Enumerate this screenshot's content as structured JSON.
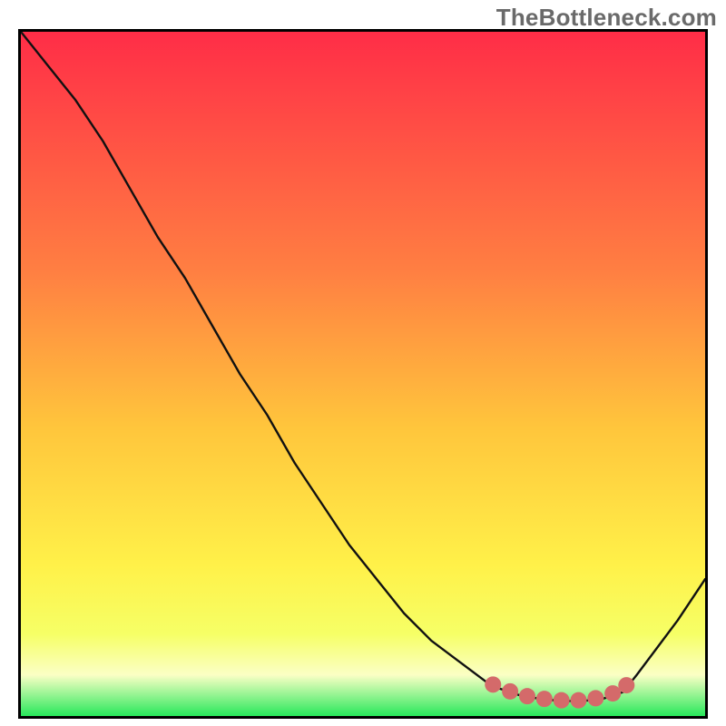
{
  "watermark": "TheBottleneck.com",
  "colors": {
    "border": "#000000",
    "curve": "#111111",
    "highlight": "#d46a6a",
    "g_top": "#ff2d47",
    "g_mid1": "#ff7f42",
    "g_mid2": "#ffc63c",
    "g_mid3": "#fff149",
    "g_mid4": "#f6ff66",
    "g_mid5": "#fbffc5",
    "g_bottom": "#28e85b"
  },
  "chart_data": {
    "type": "line",
    "title": "",
    "xlabel": "",
    "ylabel": "",
    "x": [
      0.0,
      0.04,
      0.08,
      0.12,
      0.16,
      0.2,
      0.24,
      0.28,
      0.32,
      0.36,
      0.4,
      0.44,
      0.48,
      0.52,
      0.56,
      0.6,
      0.64,
      0.68,
      0.7,
      0.73,
      0.76,
      0.79,
      0.82,
      0.85,
      0.88,
      0.9,
      0.93,
      0.96,
      1.0
    ],
    "y": [
      1.0,
      0.95,
      0.9,
      0.84,
      0.77,
      0.7,
      0.64,
      0.57,
      0.5,
      0.44,
      0.37,
      0.31,
      0.25,
      0.2,
      0.15,
      0.11,
      0.08,
      0.05,
      0.04,
      0.03,
      0.025,
      0.022,
      0.022,
      0.025,
      0.035,
      0.06,
      0.1,
      0.14,
      0.2
    ],
    "xlim": [
      0,
      1
    ],
    "ylim": [
      0,
      1
    ],
    "highlight_x_range": [
      0.68,
      0.9
    ],
    "highlight_points_x": [
      0.69,
      0.715,
      0.74,
      0.765,
      0.79,
      0.815,
      0.84,
      0.865,
      0.885
    ],
    "highlight_points_y": [
      0.046,
      0.036,
      0.029,
      0.025,
      0.023,
      0.023,
      0.026,
      0.033,
      0.045
    ]
  }
}
